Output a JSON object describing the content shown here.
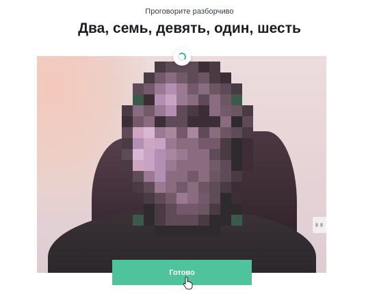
{
  "prompt": {
    "instruction": "Проговорите разборчиво",
    "phrase": "Два, семь, девять, один, шесть"
  },
  "camera": {
    "status_icon": "loading-spinner-icon"
  },
  "actions": {
    "done_label": "Готово"
  },
  "colors": {
    "accent": "#4fc39b",
    "spinner": "#38b58c",
    "heading": "#1a1d21"
  }
}
